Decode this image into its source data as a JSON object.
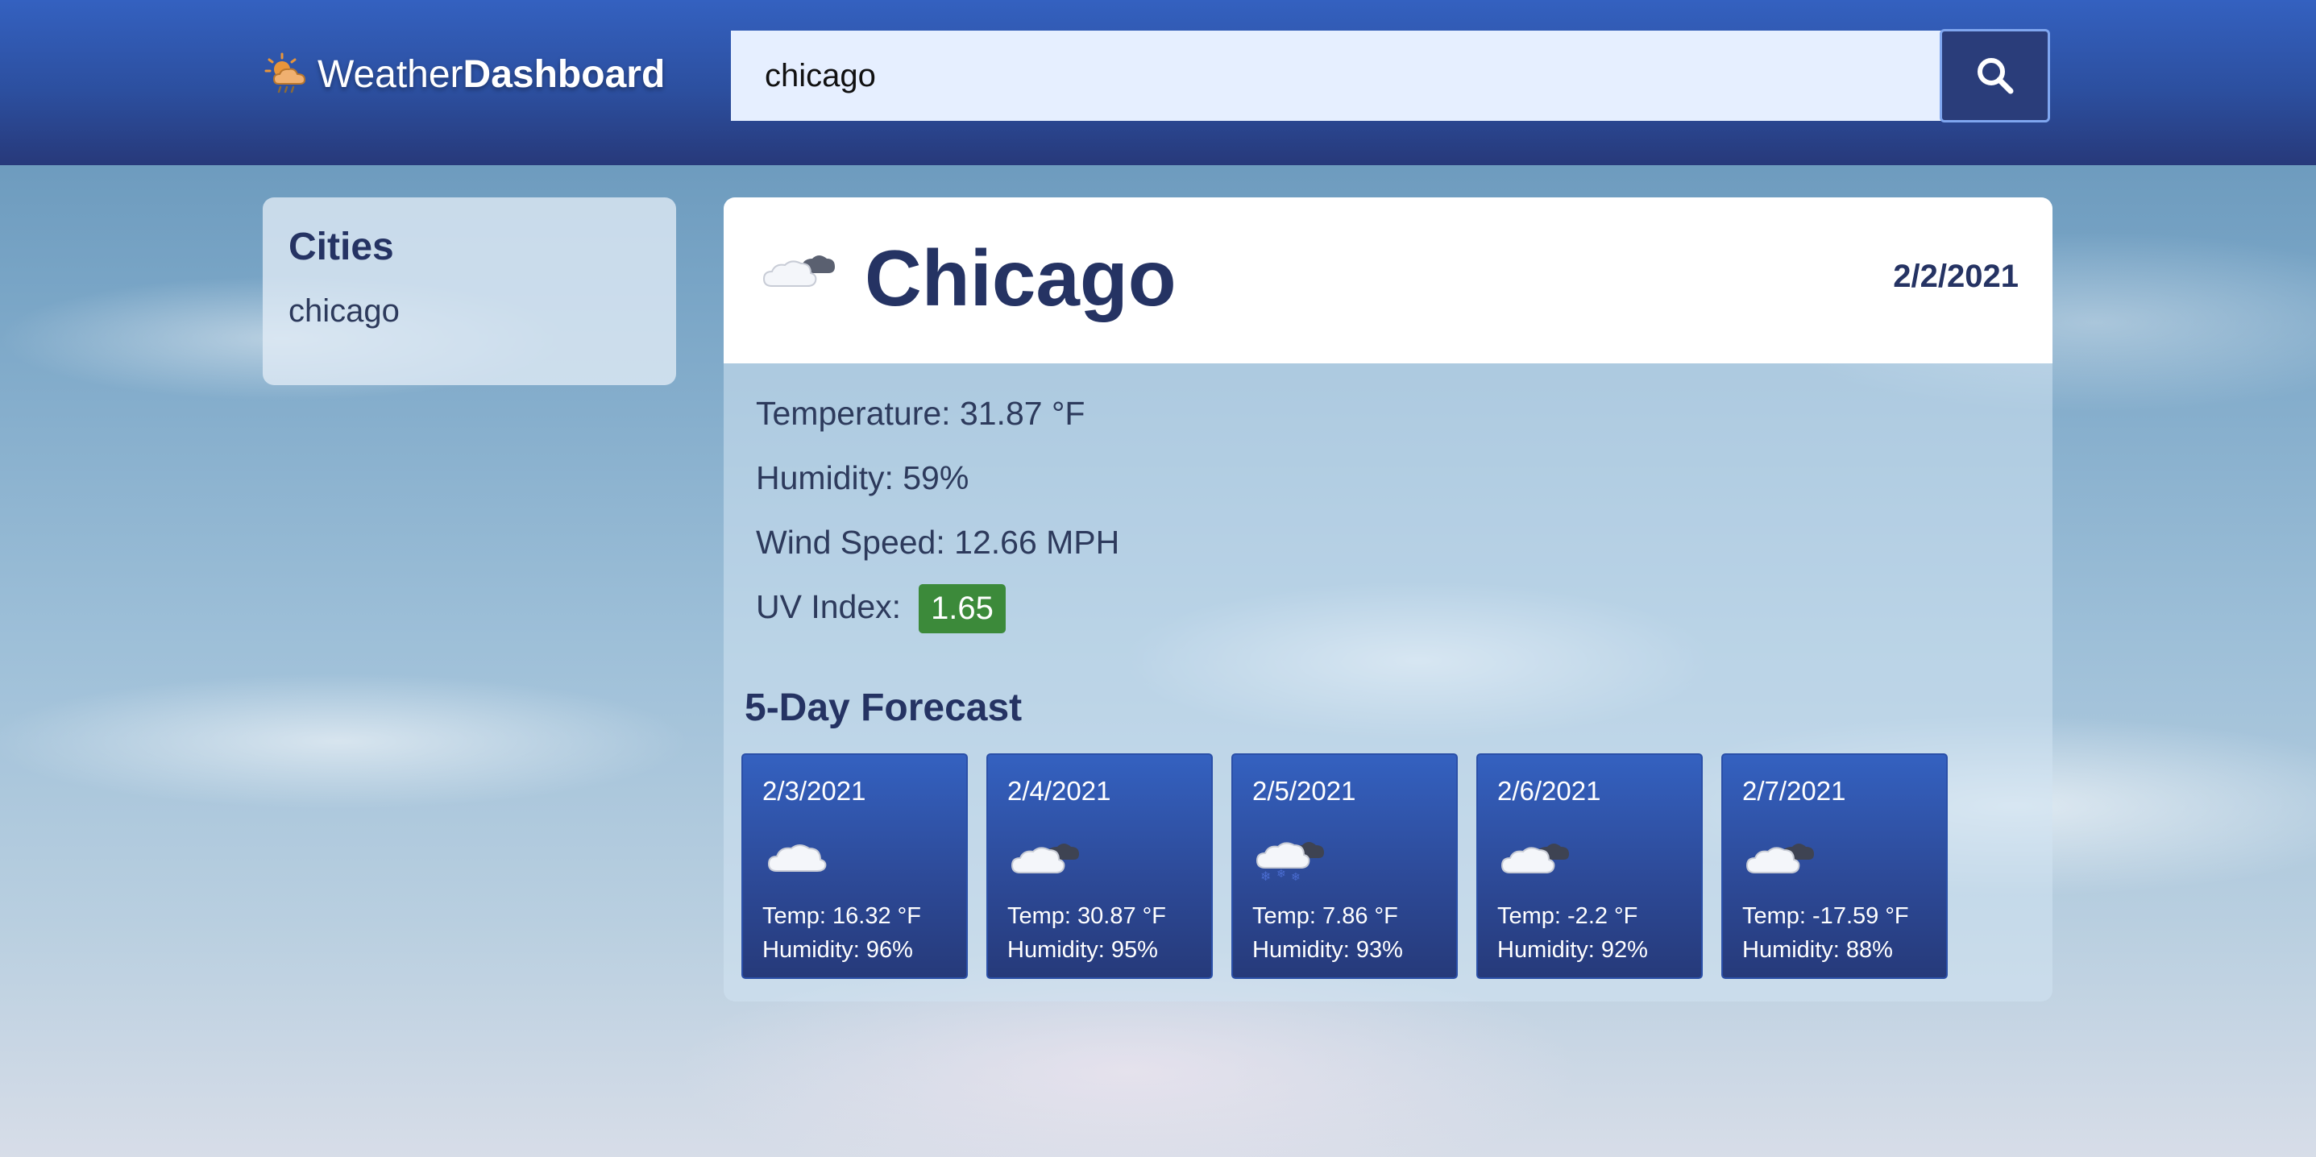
{
  "header": {
    "logo_light": "Weather",
    "logo_bold": "Dashboard",
    "logo_icon": "weather-logo-icon",
    "search_value": "chicago",
    "search_button_icon": "search-icon"
  },
  "cities": {
    "title": "Cities",
    "items": [
      "chicago"
    ]
  },
  "current": {
    "city": "Chicago",
    "date": "2/2/2021",
    "icon": "cloudy-icon",
    "temperature": "Temperature: 31.87 °F",
    "humidity": "Humidity: 59%",
    "wind": "Wind Speed: 12.66 MPH",
    "uv_label": "UV Index:",
    "uv_value": "1.65",
    "uv_color": "#3c8a3a"
  },
  "forecast": {
    "title": "5-Day Forecast",
    "days": [
      {
        "date": "2/3/2021",
        "icon": "cloud-icon",
        "temp": "Temp: 16.32 °F",
        "humidity": "Humidity: 96%"
      },
      {
        "date": "2/4/2021",
        "icon": "cloudy-icon",
        "temp": "Temp: 30.87 °F",
        "humidity": "Humidity: 95%"
      },
      {
        "date": "2/5/2021",
        "icon": "snow-icon",
        "temp": "Temp: 7.86 °F",
        "humidity": "Humidity: 93%"
      },
      {
        "date": "2/6/2021",
        "icon": "cloudy-icon",
        "temp": "Temp: -2.2 °F",
        "humidity": "Humidity: 92%"
      },
      {
        "date": "2/7/2021",
        "icon": "cloudy-icon",
        "temp": "Temp: -17.59 °F",
        "humidity": "Humidity: 88%"
      }
    ]
  },
  "colors": {
    "header": "#2c4f9f",
    "accent_dark": "#253363",
    "card": "#2d4a98"
  }
}
